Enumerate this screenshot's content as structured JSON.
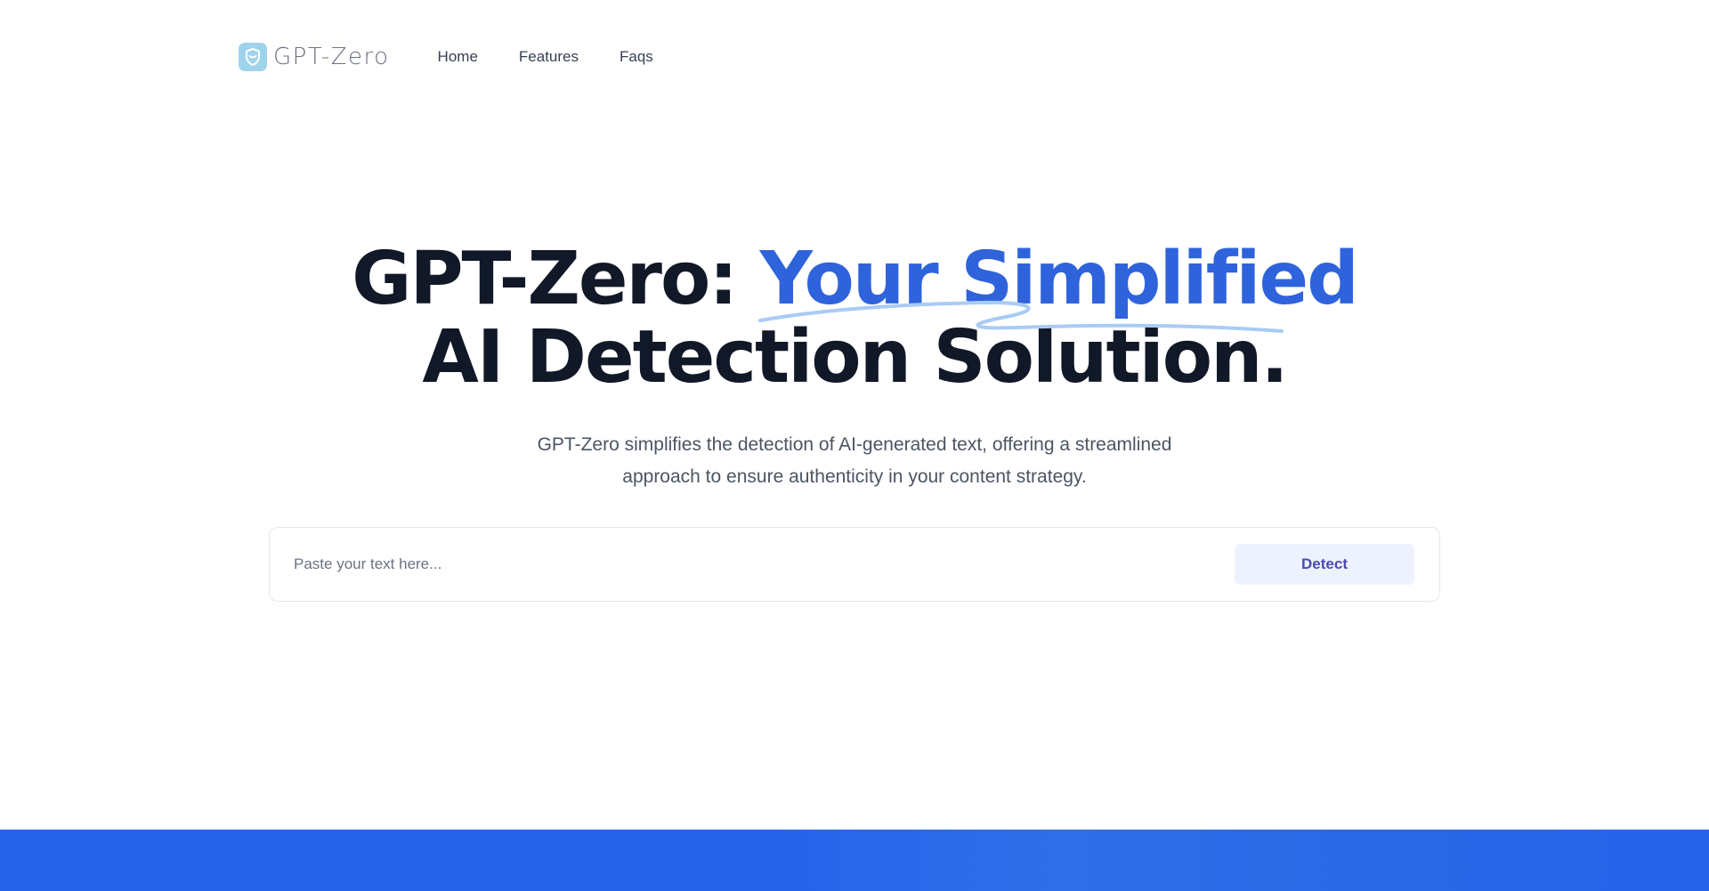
{
  "header": {
    "logo_text": "GPT-Zero",
    "logo_icon": "shield-icon",
    "nav": [
      {
        "label": "Home"
      },
      {
        "label": "Features"
      },
      {
        "label": "Faqs"
      }
    ]
  },
  "hero": {
    "title_part1": "GPT-Zero: ",
    "title_accent": "Your Simplified",
    "title_line2": "AI Detection Solution.",
    "subtitle": "GPT-Zero simplifies the detection of AI-generated text, offering a streamlined approach to ensure authenticity in your content strategy."
  },
  "detector": {
    "placeholder": "Paste your text here...",
    "value": "",
    "button_label": "Detect"
  },
  "colors": {
    "accent": "#2f63dc",
    "heading": "#111827",
    "logo_badge": "#9fd3ec",
    "band": "#2563eb",
    "button_bg": "#eef2ff",
    "button_text": "#4b4bb0"
  }
}
